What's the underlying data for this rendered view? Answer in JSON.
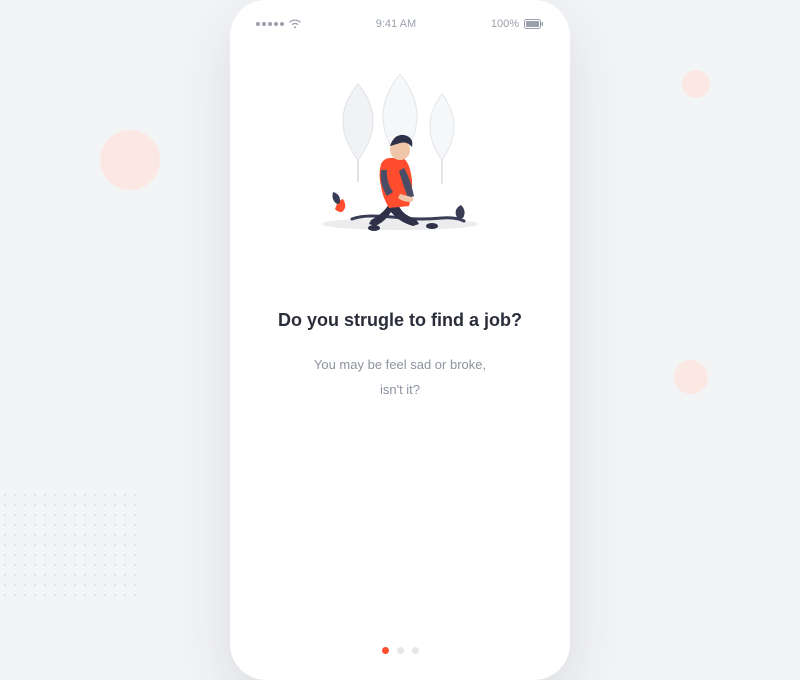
{
  "statusBar": {
    "time": "9:41 AM",
    "batteryLabel": "100%"
  },
  "onboarding": {
    "headline": "Do you strugle to find a job?",
    "subtextLine1": "You may be feel sad or broke,",
    "subtextLine2": "isn't it?",
    "currentPage": 0,
    "totalPages": 3
  },
  "colors": {
    "accent": "#ff4d2e",
    "background": "#f3f4f6",
    "textPrimary": "#2b2e3a",
    "textSecondary": "#8d93a0",
    "decorCircle": "#fce8e3"
  }
}
